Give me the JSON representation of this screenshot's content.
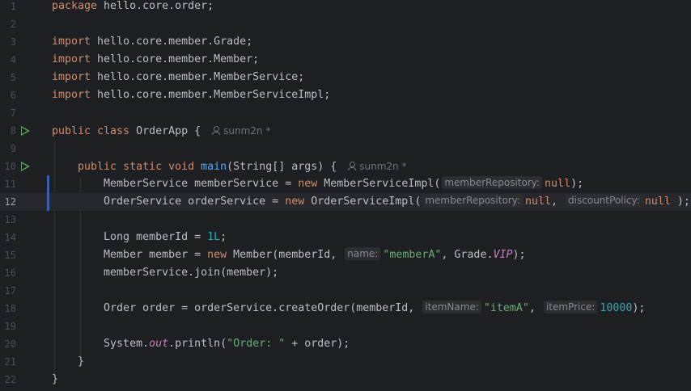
{
  "editor": {
    "lines": [
      {
        "n": "1",
        "code": [
          [
            "kw",
            "package "
          ],
          [
            "",
            "hello.core.order;"
          ]
        ]
      },
      {
        "n": "2",
        "code": []
      },
      {
        "n": "3",
        "code": [
          [
            "kw",
            "import "
          ],
          [
            "",
            "hello.core.member.Grade;"
          ]
        ]
      },
      {
        "n": "4",
        "code": [
          [
            "kw",
            "import "
          ],
          [
            "",
            "hello.core.member.Member;"
          ]
        ]
      },
      {
        "n": "5",
        "code": [
          [
            "kw",
            "import "
          ],
          [
            "",
            "hello.core.member.MemberService;"
          ]
        ]
      },
      {
        "n": "6",
        "code": [
          [
            "kw",
            "import "
          ],
          [
            "",
            "hello.core.member.MemberServiceImpl;"
          ]
        ]
      },
      {
        "n": "7",
        "code": []
      },
      {
        "n": "8",
        "run": true,
        "code": [
          [
            "kw",
            "public class "
          ],
          [
            "",
            "OrderApp {"
          ],
          [
            "author",
            "sunm2n *"
          ]
        ]
      },
      {
        "n": "9",
        "code": []
      },
      {
        "n": "10",
        "run": true,
        "code": [
          [
            "",
            "    "
          ],
          [
            "kw",
            "public static void "
          ],
          [
            "fn",
            "main"
          ],
          [
            "",
            "(String[] args) {"
          ],
          [
            "author",
            "sunm2n *"
          ]
        ]
      },
      {
        "n": "11",
        "mod": true,
        "code": [
          [
            "",
            "        MemberService memberService = "
          ],
          [
            "kw",
            "new "
          ],
          [
            "",
            "MemberServiceImpl("
          ],
          [
            "hint",
            "memberRepository:"
          ],
          [
            "kw",
            "null"
          ],
          [
            "",
            ");"
          ]
        ]
      },
      {
        "n": "12",
        "mod": true,
        "current": true,
        "code": [
          [
            "",
            "        OrderService orderService = "
          ],
          [
            "kw",
            "new "
          ],
          [
            "",
            "OrderServiceImpl("
          ],
          [
            "hint",
            "memberRepository:"
          ],
          [
            "kw",
            "null"
          ],
          [
            "",
            ", "
          ],
          [
            "hint",
            "discountPolicy:"
          ],
          [
            "kw",
            "null"
          ],
          [
            "",
            " );"
          ]
        ]
      },
      {
        "n": "13",
        "code": []
      },
      {
        "n": "14",
        "code": [
          [
            "",
            "        Long memberId = "
          ],
          [
            "num",
            "1L"
          ],
          [
            "",
            ";"
          ]
        ]
      },
      {
        "n": "15",
        "code": [
          [
            "",
            "        Member member = "
          ],
          [
            "kw",
            "new "
          ],
          [
            "",
            "Member(memberId, "
          ],
          [
            "hint",
            "name:"
          ],
          [
            "str",
            "\"memberA\""
          ],
          [
            "",
            ", Grade."
          ],
          [
            "st",
            "VIP"
          ],
          [
            "",
            ");"
          ]
        ]
      },
      {
        "n": "16",
        "code": [
          [
            "",
            "        memberService.join(member);"
          ]
        ]
      },
      {
        "n": "17",
        "code": []
      },
      {
        "n": "18",
        "code": [
          [
            "",
            "        Order order = orderService.createOrder(memberId, "
          ],
          [
            "hint",
            "itemName:"
          ],
          [
            "str",
            "\"itemA\""
          ],
          [
            "",
            ", "
          ],
          [
            "hint",
            "itemPrice:"
          ],
          [
            "num",
            "10000"
          ],
          [
            "",
            ");"
          ]
        ]
      },
      {
        "n": "19",
        "code": []
      },
      {
        "n": "20",
        "code": [
          [
            "",
            "        System."
          ],
          [
            "st",
            "out"
          ],
          [
            "",
            ".println("
          ],
          [
            "str",
            "\"Order: \""
          ],
          [
            "",
            " + order);"
          ]
        ]
      },
      {
        "n": "21",
        "code": [
          [
            "",
            "    }"
          ]
        ]
      },
      {
        "n": "22",
        "code": [
          [
            "",
            "}"
          ]
        ]
      }
    ]
  }
}
